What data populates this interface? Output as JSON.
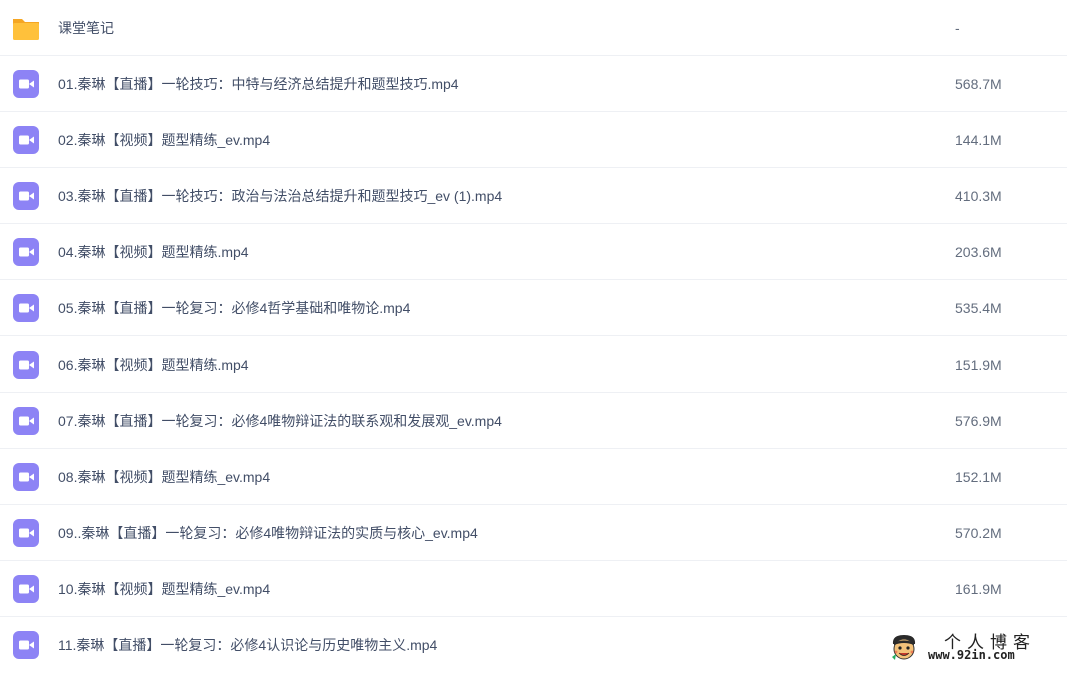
{
  "colors": {
    "folder": "#ffc13b",
    "folder_back": "#f5a623",
    "video_icon": "#8d83f5",
    "name_text": "#424e67",
    "size_text": "#636d7e",
    "divider": "#eef0f4"
  },
  "files": [
    {
      "name": "课堂笔记",
      "size": "-",
      "icon": "folder-icon"
    },
    {
      "name": "01.秦琳【直播】一轮技巧：中特与经济总结提升和题型技巧.mp4",
      "size": "568.7M",
      "icon": "video-file-icon"
    },
    {
      "name": "02.秦琳【视频】题型精练_ev.mp4",
      "size": "144.1M",
      "icon": "video-file-icon"
    },
    {
      "name": "03.秦琳【直播】一轮技巧：政治与法治总结提升和题型技巧_ev (1).mp4",
      "size": "410.3M",
      "icon": "video-file-icon"
    },
    {
      "name": "04.秦琳【视频】题型精练.mp4",
      "size": "203.6M",
      "icon": "video-file-icon"
    },
    {
      "name": "05.秦琳【直播】一轮复习：必修4哲学基础和唯物论.mp4",
      "size": "535.4M",
      "icon": "video-file-icon"
    },
    {
      "name": "06.秦琳【视频】题型精练.mp4",
      "size": "151.9M",
      "icon": "video-file-icon"
    },
    {
      "name": "07.秦琳【直播】一轮复习：必修4唯物辩证法的联系观和发展观_ev.mp4",
      "size": "576.9M",
      "icon": "video-file-icon"
    },
    {
      "name": "08.秦琳【视频】题型精练_ev.mp4",
      "size": "152.1M",
      "icon": "video-file-icon"
    },
    {
      "name": "09..秦琳【直播】一轮复习：必修4唯物辩证法的实质与核心_ev.mp4",
      "size": "570.2M",
      "icon": "video-file-icon"
    },
    {
      "name": "10.秦琳【视频】题型精练_ev.mp4",
      "size": "161.9M",
      "icon": "video-file-icon"
    },
    {
      "name": "11.秦琳【直播】一轮复习：必修4认识论与历史唯物主义.mp4",
      "size": "",
      "icon": "video-file-icon"
    }
  ],
  "watermark": {
    "title": "个人博客",
    "url": "www.92in.com",
    "icon": "cartoon-face-icon"
  }
}
